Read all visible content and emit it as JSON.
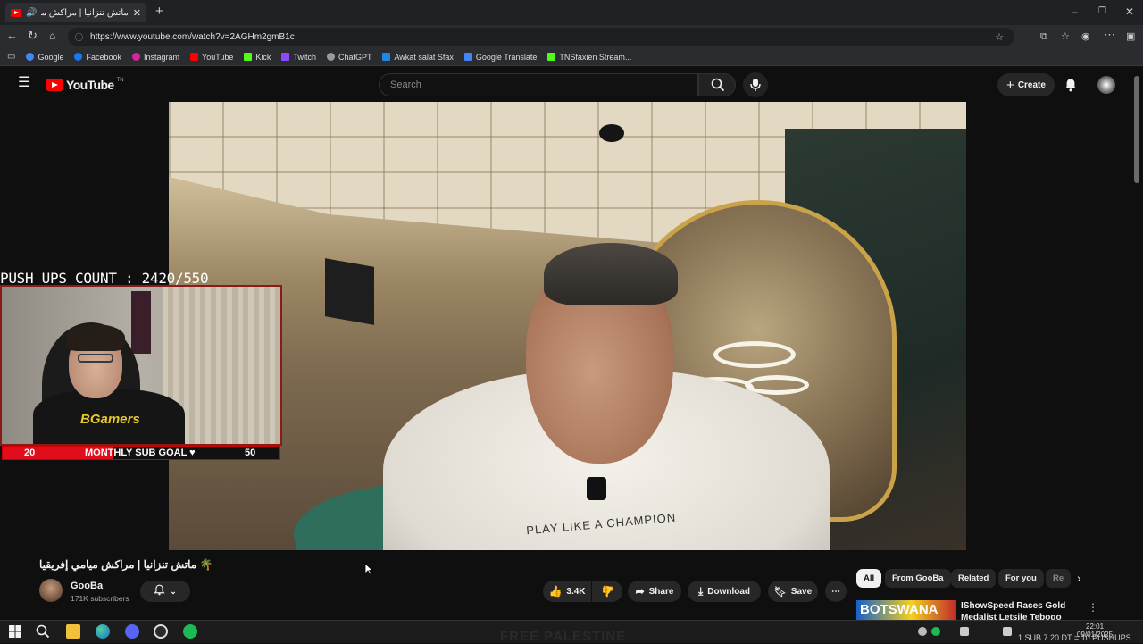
{
  "browser": {
    "tab_title": "ماتش تنزانيا | مراكش ميامي إفر",
    "url": "https://www.youtube.com/watch?v=2AGHm2gmB1c",
    "bookmarks": [
      {
        "label": "Google",
        "color": "#4285f4"
      },
      {
        "label": "Facebook",
        "color": "#1877f2"
      },
      {
        "label": "Instagram",
        "color": "#d6249f"
      },
      {
        "label": "YouTube",
        "color": "#ff0000"
      },
      {
        "label": "Kick",
        "color": "#53fc18"
      },
      {
        "label": "Twitch",
        "color": "#9146ff"
      },
      {
        "label": "ChatGPT",
        "color": "#9a9a9a"
      },
      {
        "label": "Awkat salat Sfax",
        "color": "#1e88e5"
      },
      {
        "label": "Google Translate",
        "color": "#4285f4"
      },
      {
        "label": "TNSfaxien Stream...",
        "color": "#53fc18"
      }
    ]
  },
  "youtube": {
    "logo": "YouTube",
    "logo_sup": "TN",
    "search_placeholder": "Search",
    "create_label": "Create"
  },
  "overlay": {
    "pushups": "PUSH UPS COUNT : 2420/550",
    "subgoal_current": "20",
    "subgoal_label": "MONTHLY SUB GOAL ♥",
    "subgoal_target": "50",
    "subgoal_progress": 0.4,
    "cam_logo": "BGamers",
    "shirt_text": "PLAY LIKE A CHAMPION"
  },
  "video": {
    "title": "🌴 ماتش تنزانيا | مراكش ميامي إفريقيا",
    "channel": "GooBa",
    "subscribers": "171K subscribers",
    "likes": "3.4K",
    "share_label": "Share",
    "download_label": "Download",
    "save_label": "Save"
  },
  "chips": [
    "All",
    "From GooBa",
    "Related",
    "For you",
    "Re"
  ],
  "recommendation": {
    "thumb_text": "BOTSWANA",
    "title": "IShowSpeed Races Gold Medalist Letsile Tebogo"
  },
  "taskbar": {
    "watermark": "FREE PALESTINE",
    "time": "22:01",
    "date": "09/01/2025",
    "stream_text": "1 SUB 7.20 DT = 10 PUSHUPS"
  }
}
